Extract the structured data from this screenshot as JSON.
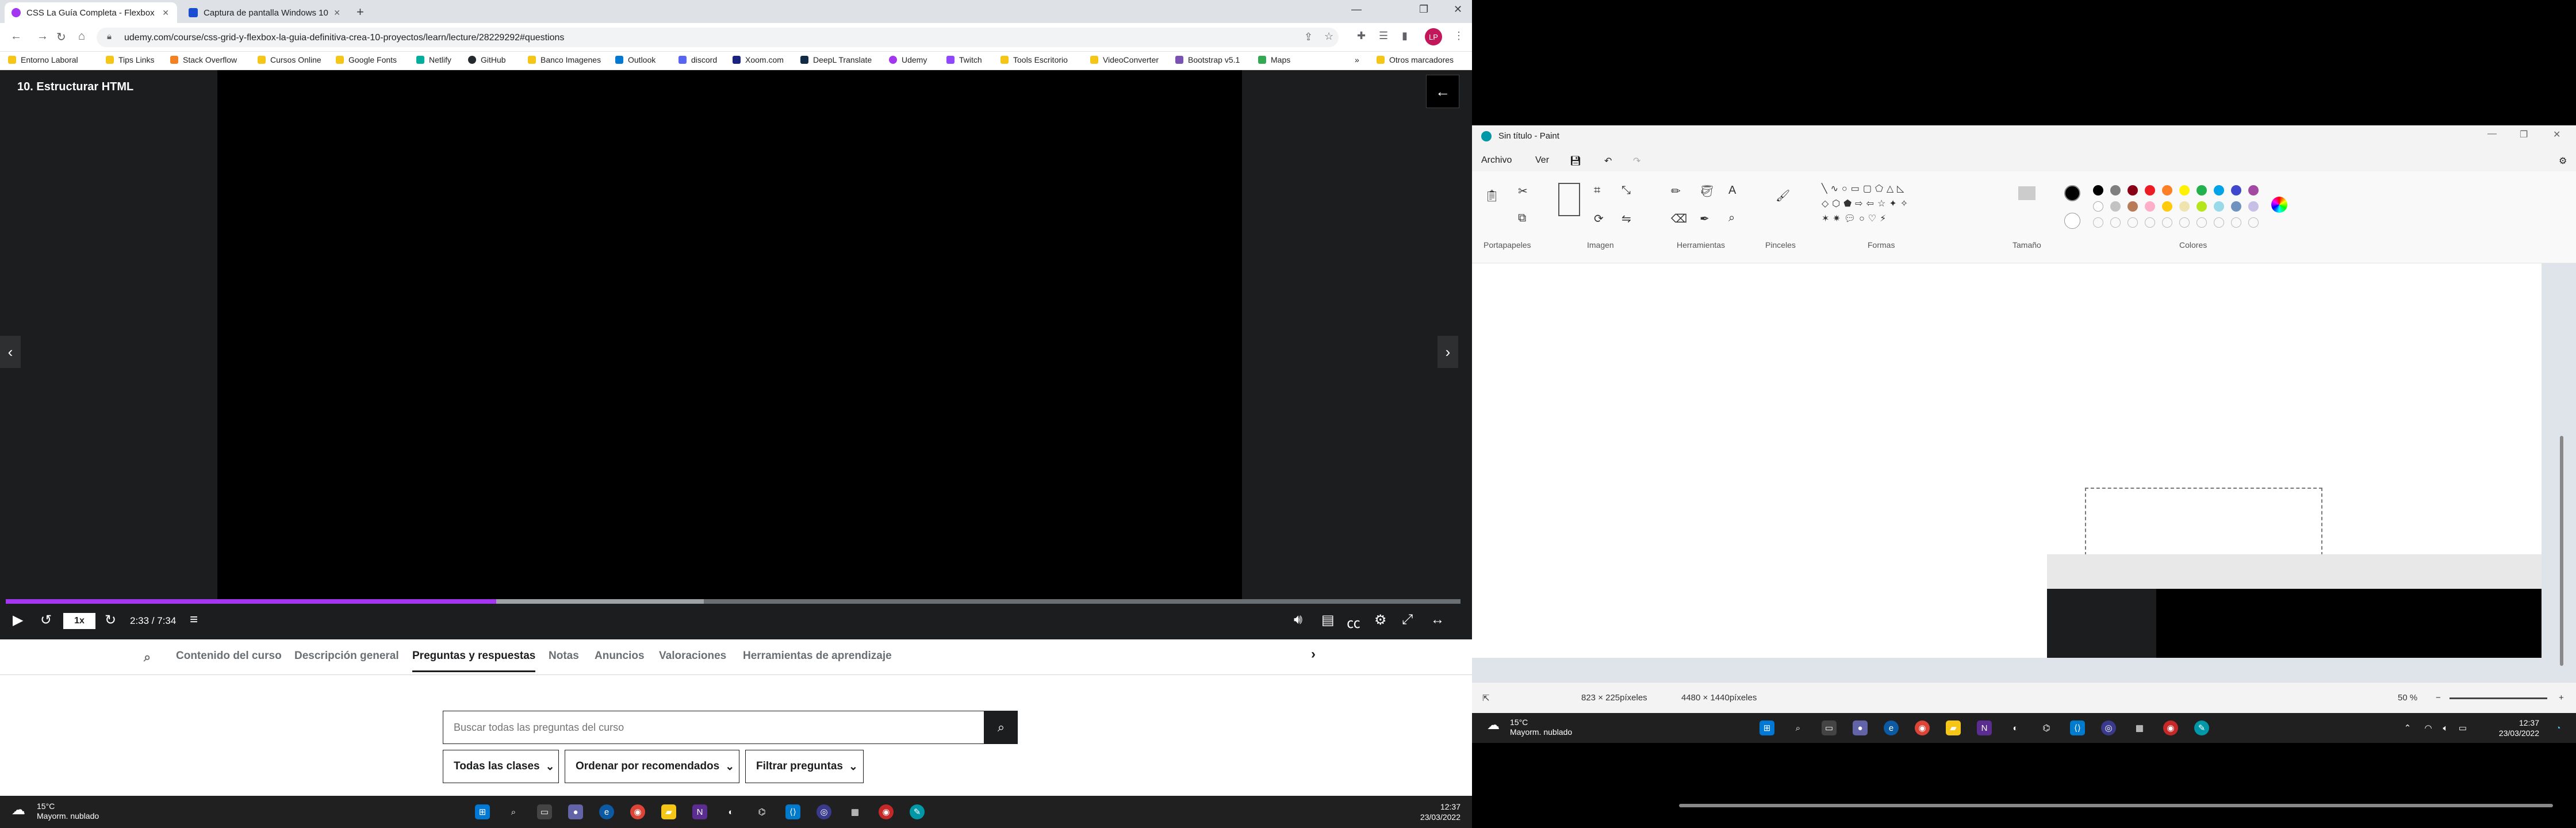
{
  "browser": {
    "tabs": [
      {
        "title": "CSS La Guía Completa - Flexbox",
        "color": "#a435f0"
      },
      {
        "title": "Captura de pantalla Windows 10",
        "color": "#1a4dd1"
      }
    ],
    "url": "udemy.com/course/css-grid-y-flexbox-la-guia-definitiva-crea-10-proyectos/learn/lecture/28229292#questions",
    "avatar": "LP",
    "bookmarks": [
      {
        "label": "Entorno Laboral",
        "color": "#f5c518"
      },
      {
        "label": "Tips Links",
        "color": "#f5c518"
      },
      {
        "label": "Stack Overflow",
        "color": "#f48024"
      },
      {
        "label": "Cursos Online",
        "color": "#f5c518"
      },
      {
        "label": "Google Fonts",
        "color": "#f5c518"
      },
      {
        "label": "Netlify",
        "color": "#00ad9f"
      },
      {
        "label": "GitHub",
        "color": "#24292e"
      },
      {
        "label": "Banco Imagenes",
        "color": "#f5c518"
      },
      {
        "label": "Outlook",
        "color": "#0078d4"
      },
      {
        "label": "discord",
        "color": "#5865f2"
      },
      {
        "label": "Xoom.com",
        "color": "#1a237e"
      },
      {
        "label": "DeepL Translate",
        "color": "#0f2b46"
      },
      {
        "label": "Udemy",
        "color": "#a435f0"
      },
      {
        "label": "Twitch",
        "color": "#9146ff"
      },
      {
        "label": "Tools Escritorio",
        "color": "#f5c518"
      },
      {
        "label": "VideoConverter",
        "color": "#f5c518"
      },
      {
        "label": "Bootstrap v5.1",
        "color": "#7952b3"
      },
      {
        "label": "Maps",
        "color": "#34a853"
      }
    ],
    "other_bookmarks": "Otros marcadores"
  },
  "player": {
    "lecture_title": "10. Estructurar HTML",
    "speed": "1x",
    "time": "2:33 / 7:34",
    "progress": 0.337,
    "buffered": 0.48
  },
  "course_tabs": [
    "Contenido del curso",
    "Descripción general",
    "Preguntas y respuestas",
    "Notas",
    "Anuncios",
    "Valoraciones",
    "Herramientas de aprendizaje"
  ],
  "qa": {
    "search_placeholder": "Buscar todas las preguntas del curso",
    "filters": [
      "Todas las clases",
      "Ordenar por recomendados",
      "Filtrar preguntas"
    ]
  },
  "taskbar": {
    "temp": "15°C",
    "weather": "Mayorm. nublado",
    "time": "12:37",
    "date": "23/03/2022"
  },
  "paint": {
    "title": "Sin título - Paint",
    "menus": [
      "Archivo",
      "Ver"
    ],
    "groups": [
      "Portapapeles",
      "Imagen",
      "Herramientas",
      "Pinceles",
      "Formas",
      "Tamaño",
      "Colores"
    ],
    "selection_size": "823 × 225píxeles",
    "image_size": "4480 × 1440píxeles",
    "zoom": "50 %"
  }
}
